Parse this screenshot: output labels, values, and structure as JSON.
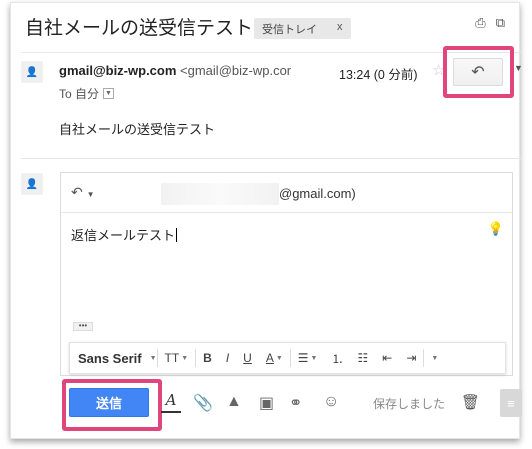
{
  "thread": {
    "subject": "自社メールの送受信テスト",
    "label": "受信トレイ",
    "label_close": "x"
  },
  "icons": {
    "print": "print-icon",
    "new_window": "new-window-icon",
    "reply": "reply-icon",
    "star": "star-icon"
  },
  "message": {
    "sender_name": "gmail@biz-wp.com",
    "sender_email": "<gmail@biz-wp.cor",
    "time": "13:24 (0 分前)",
    "to_label": "To 自分",
    "body": "自社メールの送受信テスト"
  },
  "compose": {
    "recipient": "@gmail.com)",
    "body": "返信メールテスト",
    "ellipsis": "•••"
  },
  "format_bar": {
    "font": "Sans Serif",
    "size_icon": "TT",
    "bold": "B",
    "italic": "I",
    "underline": "U",
    "text_color": "A"
  },
  "actions": {
    "send": "送信",
    "format_toggle": "A",
    "saved_status": "保存しました"
  },
  "colors": {
    "send_button": "#4285f4",
    "highlight": "#e0457b"
  }
}
